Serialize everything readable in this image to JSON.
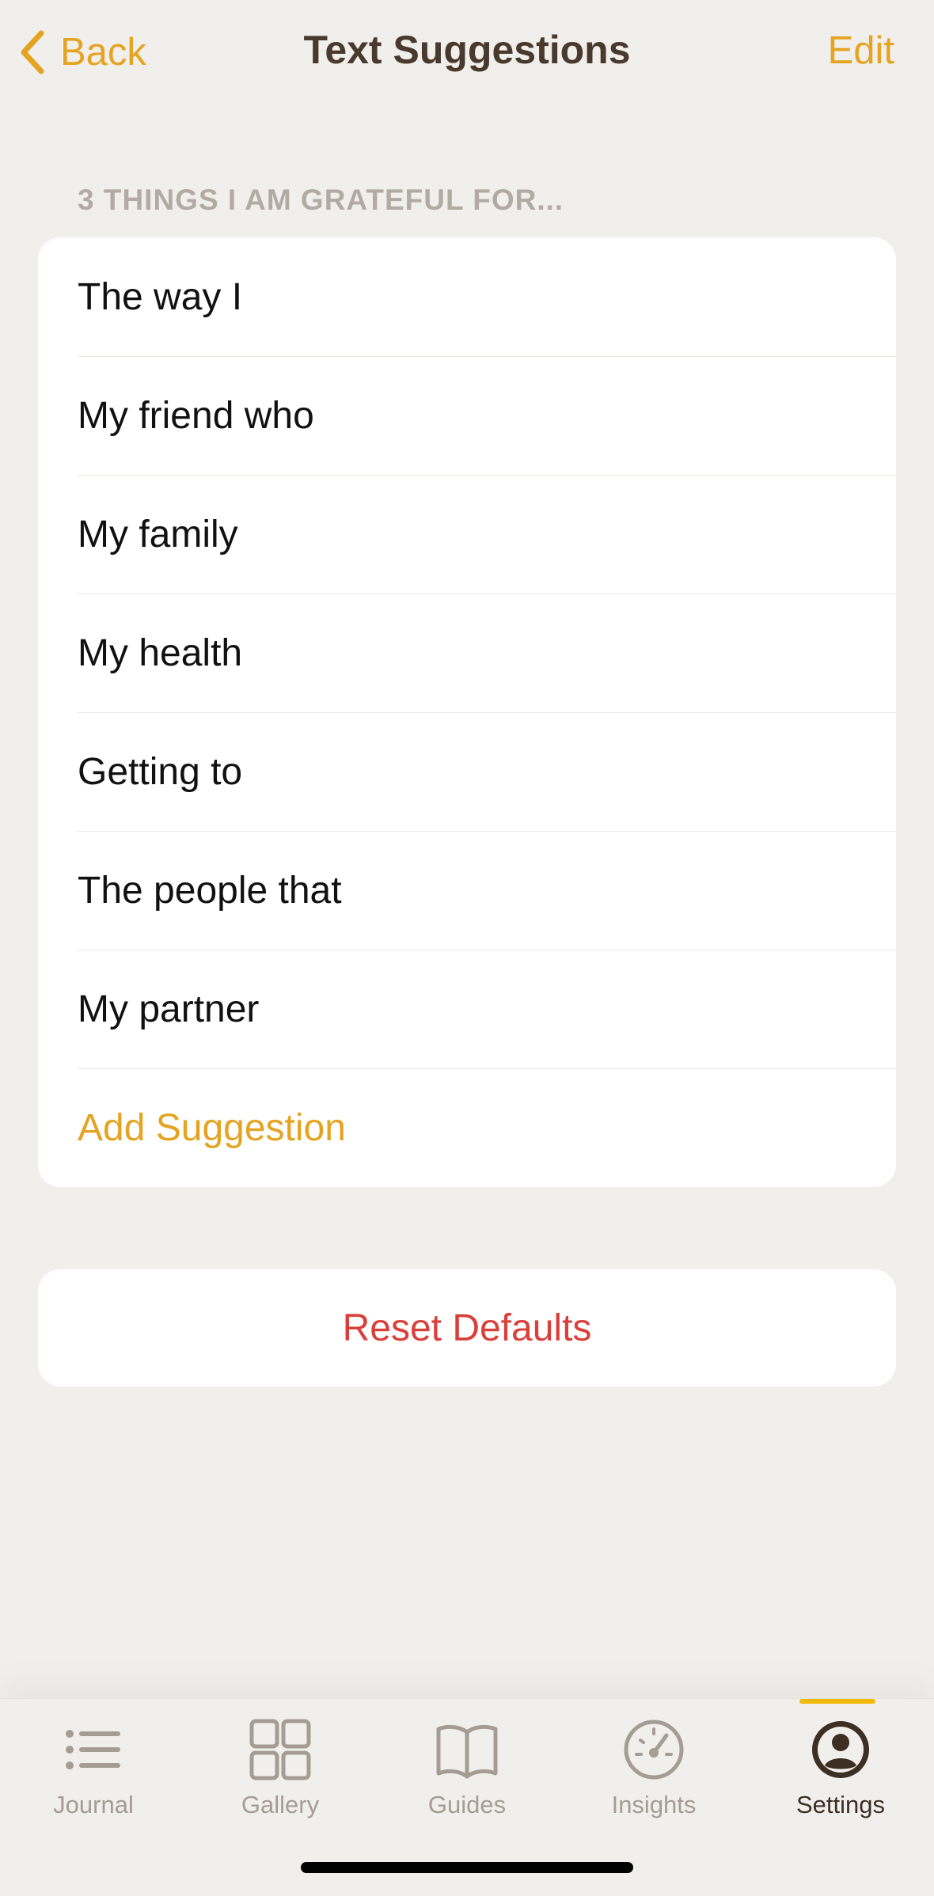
{
  "nav": {
    "back_label": "Back",
    "title": "Text Suggestions",
    "edit_label": "Edit"
  },
  "section": {
    "header": "3 THINGS I AM GRATEFUL FOR..."
  },
  "suggestions": [
    "The way I",
    "My friend who",
    "My family",
    "My health",
    "Getting to",
    "The people that",
    "My partner"
  ],
  "add_label": "Add Suggestion",
  "reset_label": "Reset Defaults",
  "tabs": [
    {
      "label": "Journal",
      "icon": "list-icon"
    },
    {
      "label": "Gallery",
      "icon": "grid-icon"
    },
    {
      "label": "Guides",
      "icon": "book-icon"
    },
    {
      "label": "Insights",
      "icon": "gauge-icon"
    },
    {
      "label": "Settings",
      "icon": "person-circle-icon",
      "active": true
    }
  ],
  "colors": {
    "accent": "#e5a322",
    "destructive": "#d9403a",
    "background": "#f1efec",
    "tab_indicator": "#f2b90f"
  }
}
